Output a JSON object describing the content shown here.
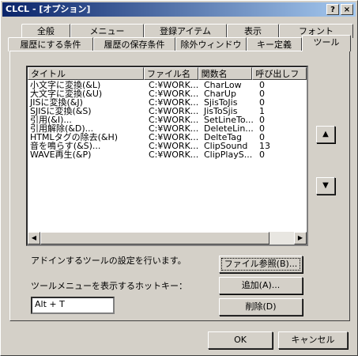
{
  "window": {
    "title": "CLCL - [オプション]"
  },
  "titlebar_buttons": {
    "help": "?",
    "close": "×"
  },
  "tabs_row_top": [
    "全般",
    "メニュー",
    "登録アイテム",
    "表示",
    "フォント"
  ],
  "tabs_row_bottom": [
    "履歴にする条件",
    "履歴の保存条件",
    "除外ウィンドウ",
    "キー定義",
    "ツール"
  ],
  "active_tab": "ツール",
  "list": {
    "columns": [
      "タイトル",
      "ファイル名",
      "関数名",
      "呼び出しフ"
    ],
    "rows": [
      [
        "小文字に変換(&L)",
        "C:¥WORK...",
        "CharLow",
        "0"
      ],
      [
        "大文字に変換(&U)",
        "C:¥WORK...",
        "CharUp",
        "0"
      ],
      [
        "JISに変換(&J)",
        "C:¥WORK...",
        "SjisToJis",
        "0"
      ],
      [
        "SJISに変換(&S)",
        "C:¥WORK...",
        "JisToSjis",
        "1"
      ],
      [
        "引用(&I)...",
        "C:¥WORK...",
        "SetLineTo...",
        "0"
      ],
      [
        "引用解除(&D)...",
        "C:¥WORK...",
        "DeleteLin...",
        "0"
      ],
      [
        "HTMLタグの除去(&H)",
        "C:¥WORK...",
        "DelteTag",
        "0"
      ],
      [
        "音を鳴らす(&S)...",
        "C:¥WORK...",
        "ClipSound",
        "13"
      ],
      [
        "WAVE再生(&P)",
        "C:¥WORK...",
        "ClipPlayS...",
        "0"
      ]
    ]
  },
  "description": "アドインするツールの設定を行います。",
  "hotkey_label": "ツールメニューを表示するホットキー：",
  "hotkey_value": "Alt + T",
  "buttons": {
    "browse": "ファイル参照(B)...",
    "add": "追加(A)...",
    "delete": "削除(D)",
    "ok": "OK",
    "cancel": "キャンセル"
  },
  "arrows": {
    "up": "▲",
    "down": "▼"
  }
}
